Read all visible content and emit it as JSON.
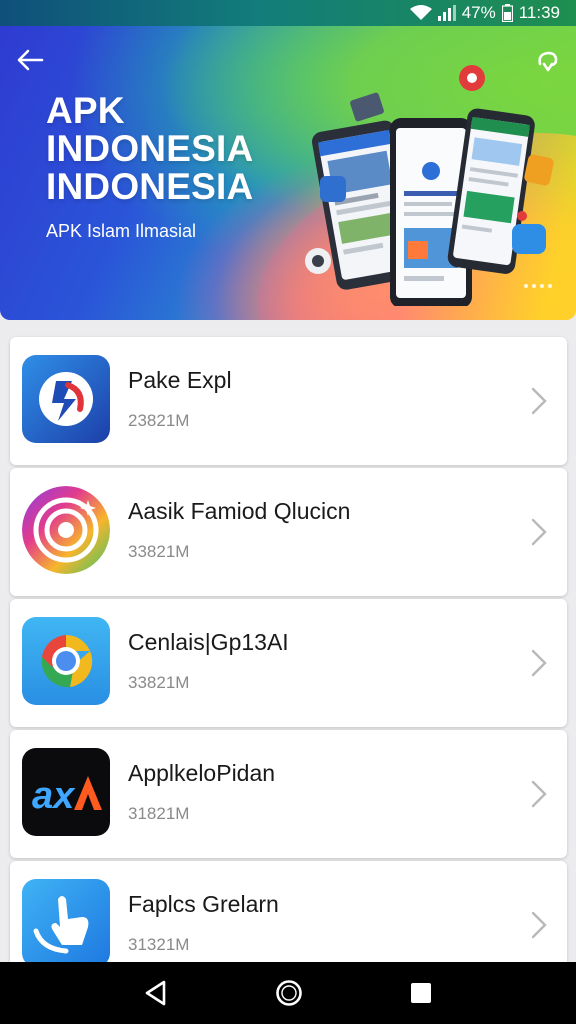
{
  "status_bar": {
    "battery": "47%",
    "time": "11:39"
  },
  "hero": {
    "title_line1": "APK",
    "title_line2": "INDONESIA",
    "title_line3": "INDONESIA",
    "subtitle": "APK Islam Ilmasial"
  },
  "apps": [
    {
      "name": "Pake Expl",
      "size": "23821M",
      "icon": "pake-app-icon"
    },
    {
      "name": "Aasik Famiod Qlucicn",
      "size": "33821M",
      "icon": "camera-ring-app-icon"
    },
    {
      "name": "Cenlais|Gp13AI",
      "size": "33821M",
      "icon": "chrome-style-app-icon"
    },
    {
      "name": "ApplkeloPidan",
      "size": "31821M",
      "icon": "ax-app-icon"
    },
    {
      "name": "Faplcs Grelarn",
      "size": "31321M",
      "icon": "hand-app-icon"
    }
  ],
  "colors": {
    "accent_blue": "#2a55d8",
    "card_bg": "#ffffff",
    "list_bg": "#ececef"
  }
}
